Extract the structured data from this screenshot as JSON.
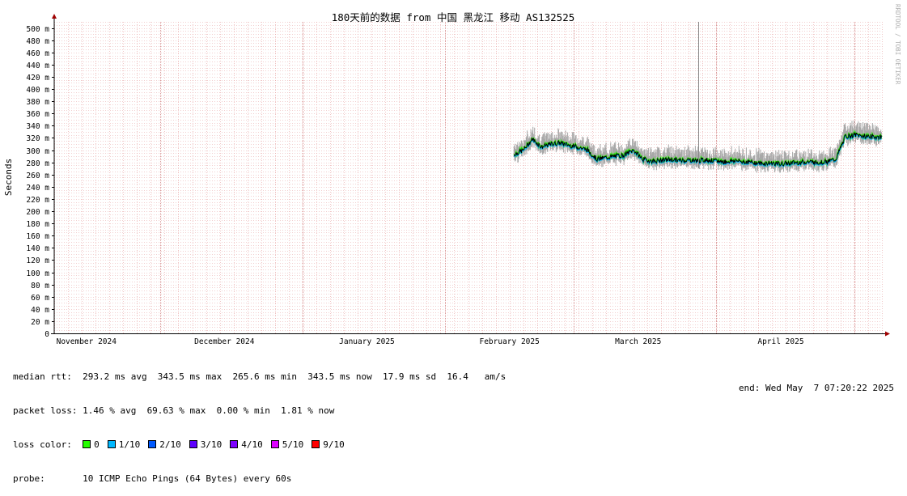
{
  "chart_data": {
    "type": "line",
    "title": "180天前的数据 from 中国 黑龙江 移动 AS132525",
    "ylabel": "Seconds",
    "ylim": [
      0,
      0.51
    ],
    "y_ticks": [
      {
        "value": 0,
        "label": "0"
      },
      {
        "value": 0.02,
        "label": "20 m"
      },
      {
        "value": 0.04,
        "label": "40 m"
      },
      {
        "value": 0.06,
        "label": "60 m"
      },
      {
        "value": 0.08,
        "label": "80 m"
      },
      {
        "value": 0.1,
        "label": "100 m"
      },
      {
        "value": 0.12,
        "label": "120 m"
      },
      {
        "value": 0.14,
        "label": "140 m"
      },
      {
        "value": 0.16,
        "label": "160 m"
      },
      {
        "value": 0.18,
        "label": "180 m"
      },
      {
        "value": 0.2,
        "label": "200 m"
      },
      {
        "value": 0.22,
        "label": "220 m"
      },
      {
        "value": 0.24,
        "label": "240 m"
      },
      {
        "value": 0.26,
        "label": "260 m"
      },
      {
        "value": 0.28,
        "label": "280 m"
      },
      {
        "value": 0.3,
        "label": "300 m"
      },
      {
        "value": 0.32,
        "label": "320 m"
      },
      {
        "value": 0.34,
        "label": "340 m"
      },
      {
        "value": 0.36,
        "label": "360 m"
      },
      {
        "value": 0.38,
        "label": "380 m"
      },
      {
        "value": 0.4,
        "label": "400 m"
      },
      {
        "value": 0.42,
        "label": "420 m"
      },
      {
        "value": 0.44,
        "label": "440 m"
      },
      {
        "value": 0.46,
        "label": "460 m"
      },
      {
        "value": 0.48,
        "label": "480 m"
      },
      {
        "value": 0.5,
        "label": "500 m"
      }
    ],
    "xlim": [
      "2024-11-08",
      "2025-05-07"
    ],
    "x_ticks": [
      {
        "date": "2024-11-15",
        "label": "November 2024"
      },
      {
        "date": "2024-12-15",
        "label": "December 2024"
      },
      {
        "date": "2025-01-15",
        "label": "January 2025"
      },
      {
        "date": "2025-02-15",
        "label": "February 2025"
      },
      {
        "date": "2025-03-15",
        "label": "March 2025"
      },
      {
        "date": "2025-04-15",
        "label": "April 2025"
      }
    ],
    "series": [
      {
        "x": [
          "2025-02-16",
          "2025-02-18",
          "2025-02-20",
          "2025-02-22",
          "2025-02-24",
          "2025-02-26",
          "2025-02-28",
          "2025-03-02",
          "2025-03-04",
          "2025-03-06",
          "2025-03-08",
          "2025-03-10",
          "2025-03-12",
          "2025-03-14",
          "2025-03-16",
          "2025-03-18",
          "2025-03-20",
          "2025-03-22",
          "2025-03-24",
          "2025-03-26",
          "2025-03-28",
          "2025-03-30",
          "2025-04-01",
          "2025-04-03",
          "2025-04-05",
          "2025-04-07",
          "2025-04-09",
          "2025-04-11",
          "2025-04-13",
          "2025-04-15",
          "2025-04-17",
          "2025-04-19",
          "2025-04-21",
          "2025-04-23",
          "2025-04-25",
          "2025-04-27",
          "2025-04-29",
          "2025-05-01",
          "2025-05-03",
          "2025-05-05",
          "2025-05-07"
        ],
        "y": [
          0.293,
          0.3,
          0.318,
          0.305,
          0.31,
          0.312,
          0.308,
          0.305,
          0.3,
          0.285,
          0.288,
          0.29,
          0.292,
          0.3,
          0.285,
          0.282,
          0.283,
          0.285,
          0.283,
          0.284,
          0.283,
          0.284,
          0.282,
          0.281,
          0.283,
          0.281,
          0.28,
          0.278,
          0.279,
          0.277,
          0.279,
          0.28,
          0.281,
          0.28,
          0.281,
          0.285,
          0.322,
          0.325,
          0.323,
          0.322,
          0.321
        ]
      }
    ],
    "spike": {
      "date": "2025-03-28",
      "value": 0.51
    },
    "grid": true
  },
  "legend": {
    "median_rtt": "median rtt:  293.2 ms avg  343.5 ms max  265.6 ms min  343.5 ms now  17.9 ms sd  16.4   am/s",
    "packet_loss": "packet loss: 1.46 % avg  69.63 % max  0.00 % min  1.81 % now",
    "loss_color_label": "loss color:",
    "loss_colors": [
      {
        "label": "0",
        "color": "#26ff00"
      },
      {
        "label": "1/10",
        "color": "#00b8ff"
      },
      {
        "label": "2/10",
        "color": "#0059ff"
      },
      {
        "label": "3/10",
        "color": "#5e00ff"
      },
      {
        "label": "4/10",
        "color": "#7e00ff"
      },
      {
        "label": "5/10",
        "color": "#dd00ff"
      },
      {
        "label": "9/10",
        "color": "#ff0000"
      }
    ],
    "probe": "probe:       10 ICMP Echo Pings (64 Bytes) every 60s",
    "end": "end: Wed May  7 07:20:22 2025"
  },
  "watermark": "RRDTOOL / TOBI OETIKER",
  "colors": {
    "grid_minor": "#e6a0a0",
    "grid_major": "#d08080",
    "axis": "#000000",
    "arrow": "#a00000",
    "smoke": "#a8a8a8",
    "median": "#000000"
  }
}
